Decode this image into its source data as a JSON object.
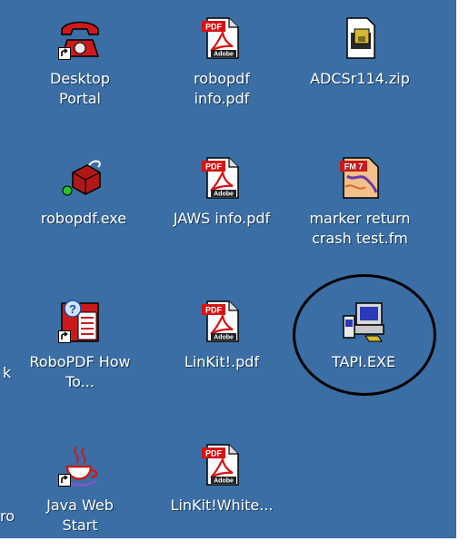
{
  "colors": {
    "desktop_background": "#3a6ea5",
    "label_text": "#ffffff",
    "annotation_circle": "#000000"
  },
  "partial_labels": [
    "k",
    "ro"
  ],
  "icons": [
    {
      "label": "Desktop Portal",
      "icon": "red-telephone-icon",
      "shortcut": true
    },
    {
      "label": "robopdf\ninfo.pdf",
      "icon": "pdf-document-icon",
      "shortcut": false
    },
    {
      "label": "ADCSr114.zip",
      "icon": "zip-archive-icon",
      "shortcut": false
    },
    {
      "label": "robopdf.exe",
      "icon": "red-package-icon",
      "shortcut": false
    },
    {
      "label": "JAWS info.pdf",
      "icon": "pdf-document-icon",
      "shortcut": false
    },
    {
      "label": "marker return\ncrash test.fm",
      "icon": "framemaker-document-icon",
      "shortcut": false
    },
    {
      "label": "RoboPDF How\nTo...",
      "icon": "help-document-icon",
      "shortcut": true
    },
    {
      "label": "LinKit!.pdf",
      "icon": "pdf-document-icon",
      "shortcut": false
    },
    {
      "label": "TAPI.EXE",
      "icon": "computer-setup-icon",
      "shortcut": false
    },
    {
      "label": "Java Web\nStart",
      "icon": "java-cup-icon",
      "shortcut": true
    },
    {
      "label": "LinKit!White...",
      "icon": "pdf-document-icon",
      "shortcut": false
    }
  ]
}
